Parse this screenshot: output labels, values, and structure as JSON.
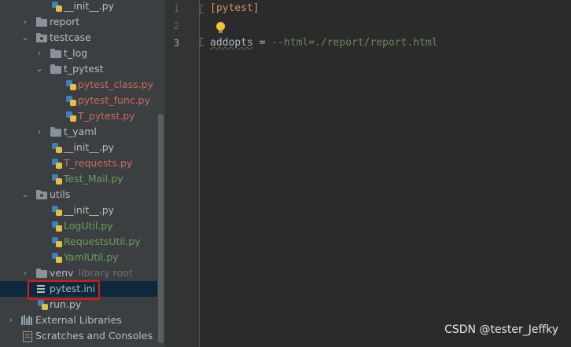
{
  "tree": {
    "items": [
      {
        "label": "__init__.py",
        "kind": "python",
        "color": "default"
      },
      {
        "label": "report",
        "kind": "folder",
        "expanded": false
      },
      {
        "label": "testcase",
        "kind": "folder",
        "expanded": true
      },
      {
        "label": "t_log",
        "kind": "folder",
        "expanded": false
      },
      {
        "label": "t_pytest",
        "kind": "folder",
        "expanded": true
      },
      {
        "label": "pytest_class.py",
        "kind": "python",
        "color": "modified"
      },
      {
        "label": "pytest_func.py",
        "kind": "python",
        "color": "modified"
      },
      {
        "label": "T_pytest.py",
        "kind": "python",
        "color": "modified"
      },
      {
        "label": "t_yaml",
        "kind": "folder",
        "expanded": false
      },
      {
        "label": "__init__.py",
        "kind": "python",
        "color": "default"
      },
      {
        "label": "T_requests.py",
        "kind": "python",
        "color": "modified"
      },
      {
        "label": "Test_Mail.py",
        "kind": "python",
        "color": "added"
      },
      {
        "label": "utils",
        "kind": "folder",
        "expanded": true
      },
      {
        "label": "__init__.py",
        "kind": "python",
        "color": "default"
      },
      {
        "label": "LogUtil.py",
        "kind": "python",
        "color": "added"
      },
      {
        "label": "RequestsUtil.py",
        "kind": "python",
        "color": "added"
      },
      {
        "label": "YamlUtil.py",
        "kind": "python",
        "color": "added"
      },
      {
        "label": "venv",
        "kind": "folder",
        "expanded": false,
        "hint": "library root"
      },
      {
        "label": "pytest.ini",
        "kind": "ini",
        "selected": true
      },
      {
        "label": "run.py",
        "kind": "python",
        "color": "default"
      },
      {
        "label": "External Libraries",
        "kind": "libraries"
      },
      {
        "label": "Scratches and Consoles",
        "kind": "scratches"
      }
    ]
  },
  "editor": {
    "line_numbers": [
      "1",
      "2",
      "3"
    ],
    "current_line": "3",
    "line1": {
      "section": "[pytest]"
    },
    "line3": {
      "key": "addopts",
      "equals": " = ",
      "value": "--html=./report/report.html"
    }
  },
  "watermark": "CSDN @tester_Jeffky",
  "colors": {
    "modified": "#cf6a5a",
    "added": "#6a9e55",
    "highlight_box": "#e0171b",
    "selection": "#0d293e",
    "section_header": "#d0925f",
    "string_value": "#6a8759"
  }
}
